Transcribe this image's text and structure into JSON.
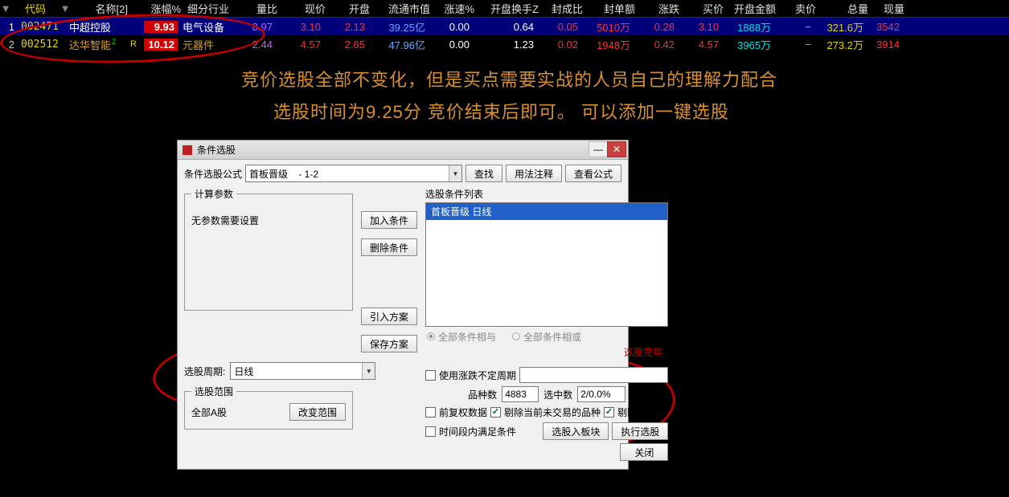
{
  "table": {
    "headers": {
      "dd1": "▼",
      "code": "代码",
      "dd2": "▼",
      "name": "名称[2]",
      "pct": "涨幅%",
      "industry": "细分行业",
      "volratio": "量比",
      "price": "现价",
      "open": "开盘",
      "mcap": "流通市值",
      "speed": "涨速%",
      "turnover": "开盘换手Z",
      "sealratio": "封成比",
      "sealamt": "封单额",
      "zd": "涨跌",
      "buy": "买价",
      "openamt": "开盘金额",
      "sell": "卖价",
      "vol": "总量",
      "last": "现量"
    },
    "rows": [
      {
        "idx": "1",
        "code": "002471",
        "name": "中超控股",
        "nameFlag": "",
        "rflag": "",
        "pct": "9.93",
        "industry": "电气设备",
        "volratio": "8.97",
        "price": "3.10",
        "open": "2.13",
        "mcap": "39.25亿",
        "speed": "0.00",
        "turnover": "0.64",
        "sealratio": "0.05",
        "sealamt": "5010万",
        "zd": "0.28",
        "buy": "3.10",
        "openamt": "1888万",
        "sell": "−",
        "vol": "321.6万",
        "last": "3542"
      },
      {
        "idx": "2",
        "code": "002512",
        "name": "达华智能",
        "nameFlag": "Z",
        "rflag": "R",
        "pct": "10.12",
        "industry": "元器件",
        "volratio": "2.44",
        "price": "4.57",
        "open": "2.65",
        "mcap": "47.96亿",
        "speed": "0.00",
        "turnover": "1.23",
        "sealratio": "0.02",
        "sealamt": "1948万",
        "zd": "0.42",
        "buy": "4.57",
        "openamt": "3965万",
        "sell": "−",
        "vol": "273.2万",
        "last": "3914"
      }
    ]
  },
  "annotation": {
    "line1": "竞价选股全部不变化，但是买点需要实战的人员自己的理解力配合",
    "line2": "选股时间为9.25分 竞价结束后即可。 可以添加一键选股"
  },
  "dialog": {
    "title": "条件选股",
    "formulaLabel": "条件选股公式",
    "formulaValue": "首板晋级    - 1-2",
    "btnFind": "查找",
    "btnUsage": "用法注释",
    "btnViewFormula": "查看公式",
    "groupParams": "计算参数",
    "noParams": "无参数需要设置",
    "periodLabel": "选股周期:",
    "periodValue": "日线",
    "groupRange": "选股范围",
    "rangeValue": "全部A股",
    "btnChangeRange": "改变范围",
    "btnAddCond": "加入条件",
    "btnDelCond": "删除条件",
    "btnImport": "引入方案",
    "btnSave": "保存方案",
    "listTitle": "选股条件列表",
    "listItem1": "首板晋级  日线",
    "radioAnd": "全部条件相与",
    "radioOr": "全部条件相或",
    "statusDone": "选股完毕.",
    "chkUsePeriod": "使用涨跌不定周期",
    "periodInputValue": "",
    "lblTotal": "品种数",
    "totalValue": "4883",
    "lblHit": "选中数",
    "hitValue": "2/0.0%",
    "chkFuquan": "前复权数据",
    "chkExcludeNoTrade": "剔除当前未交易的品种",
    "chkExcludeST": "剔除ST品种",
    "chkTimeRange": "时间段内满足条件",
    "btnToBlock": "选股入板块",
    "btnRun": "执行选股",
    "btnClose": "关闭"
  }
}
